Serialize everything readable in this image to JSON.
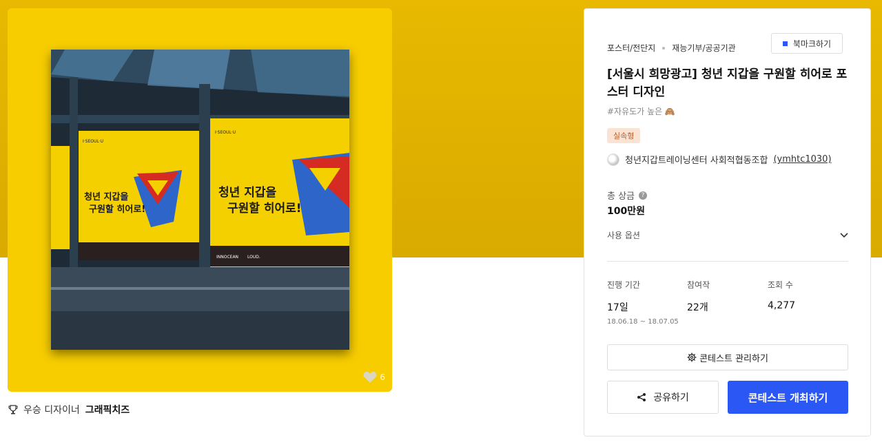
{
  "hero": {
    "like_count": "6",
    "poster_text": {
      "brand": "I·SEOUL·U",
      "headline_1": "청년 지갑을",
      "headline_2": "구원할 히어로!",
      "sponsor_1": "INNOCEAN",
      "sponsor_2": "LOUD."
    }
  },
  "winner": {
    "label": "우승 디자이너",
    "name": "그래픽치즈"
  },
  "panel": {
    "category": "포스터/전단지",
    "subcategory": "재능기부/공공기관",
    "bookmark_label": "북마크하기",
    "title": "[서울시 희망광고] 청년 지갑을 구원할 히어로 포스터 디자인",
    "tagline": "#자유도가 높은 🙈",
    "badge": "실속형",
    "host_name": "청년지갑트레이닝센터 사회적협동조합",
    "host_id": "(ymhtc1030)",
    "prize_label": "총 상금",
    "prize_help": "?",
    "prize_value": "100만원",
    "option_label": "사용 옵션",
    "stats": {
      "period_label": "진행 기간",
      "period_value": "17일",
      "period_range": "18.06.18 ~ 18.07.05",
      "entries_label": "참여작",
      "entries_value": "22개",
      "views_label": "조회 수",
      "views_value": "4,277"
    },
    "manage_label": "콘테스트 관리하기",
    "share_label": "공유하기",
    "host_contest_label": "콘테스트 개최하기"
  }
}
